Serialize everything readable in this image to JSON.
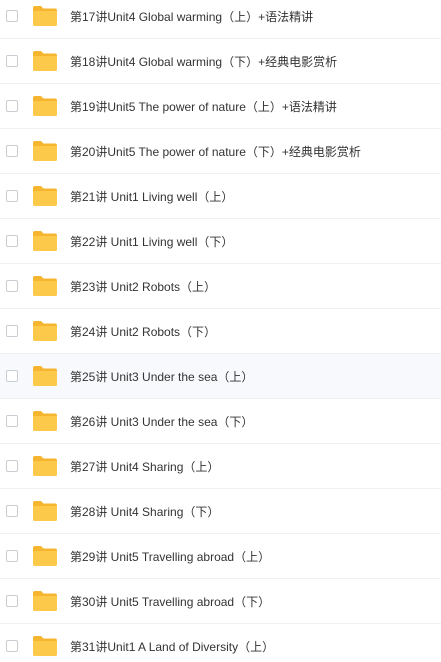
{
  "files": [
    {
      "name": "第17讲Unit4 Global warming（上）+语法精讲"
    },
    {
      "name": "第18讲Unit4 Global warming（下）+经典电影赏析"
    },
    {
      "name": "第19讲Unit5 The power of nature（上）+语法精讲"
    },
    {
      "name": "第20讲Unit5 The power of nature（下）+经典电影赏析"
    },
    {
      "name": "第21讲 Unit1 Living well（上）"
    },
    {
      "name": "第22讲 Unit1 Living well（下）"
    },
    {
      "name": "第23讲 Unit2 Robots（上）"
    },
    {
      "name": "第24讲 Unit2 Robots（下）"
    },
    {
      "name": "第25讲 Unit3 Under the sea（上）"
    },
    {
      "name": "第26讲 Unit3 Under the sea（下）"
    },
    {
      "name": "第27讲 Unit4 Sharing（上）"
    },
    {
      "name": "第28讲 Unit4 Sharing（下）"
    },
    {
      "name": "第29讲 Unit5 Travelling abroad（上）"
    },
    {
      "name": "第30讲 Unit5 Travelling abroad（下）"
    },
    {
      "name": "第31讲Unit1 A Land of Diversity（上）"
    }
  ],
  "colors": {
    "folder_body": "#fcc94a",
    "folder_tab": "#f5b52e",
    "text": "#333333",
    "hover_row": "#f7f9fc"
  },
  "icons": {
    "folder": "folder-icon",
    "checkbox": "checkbox"
  }
}
